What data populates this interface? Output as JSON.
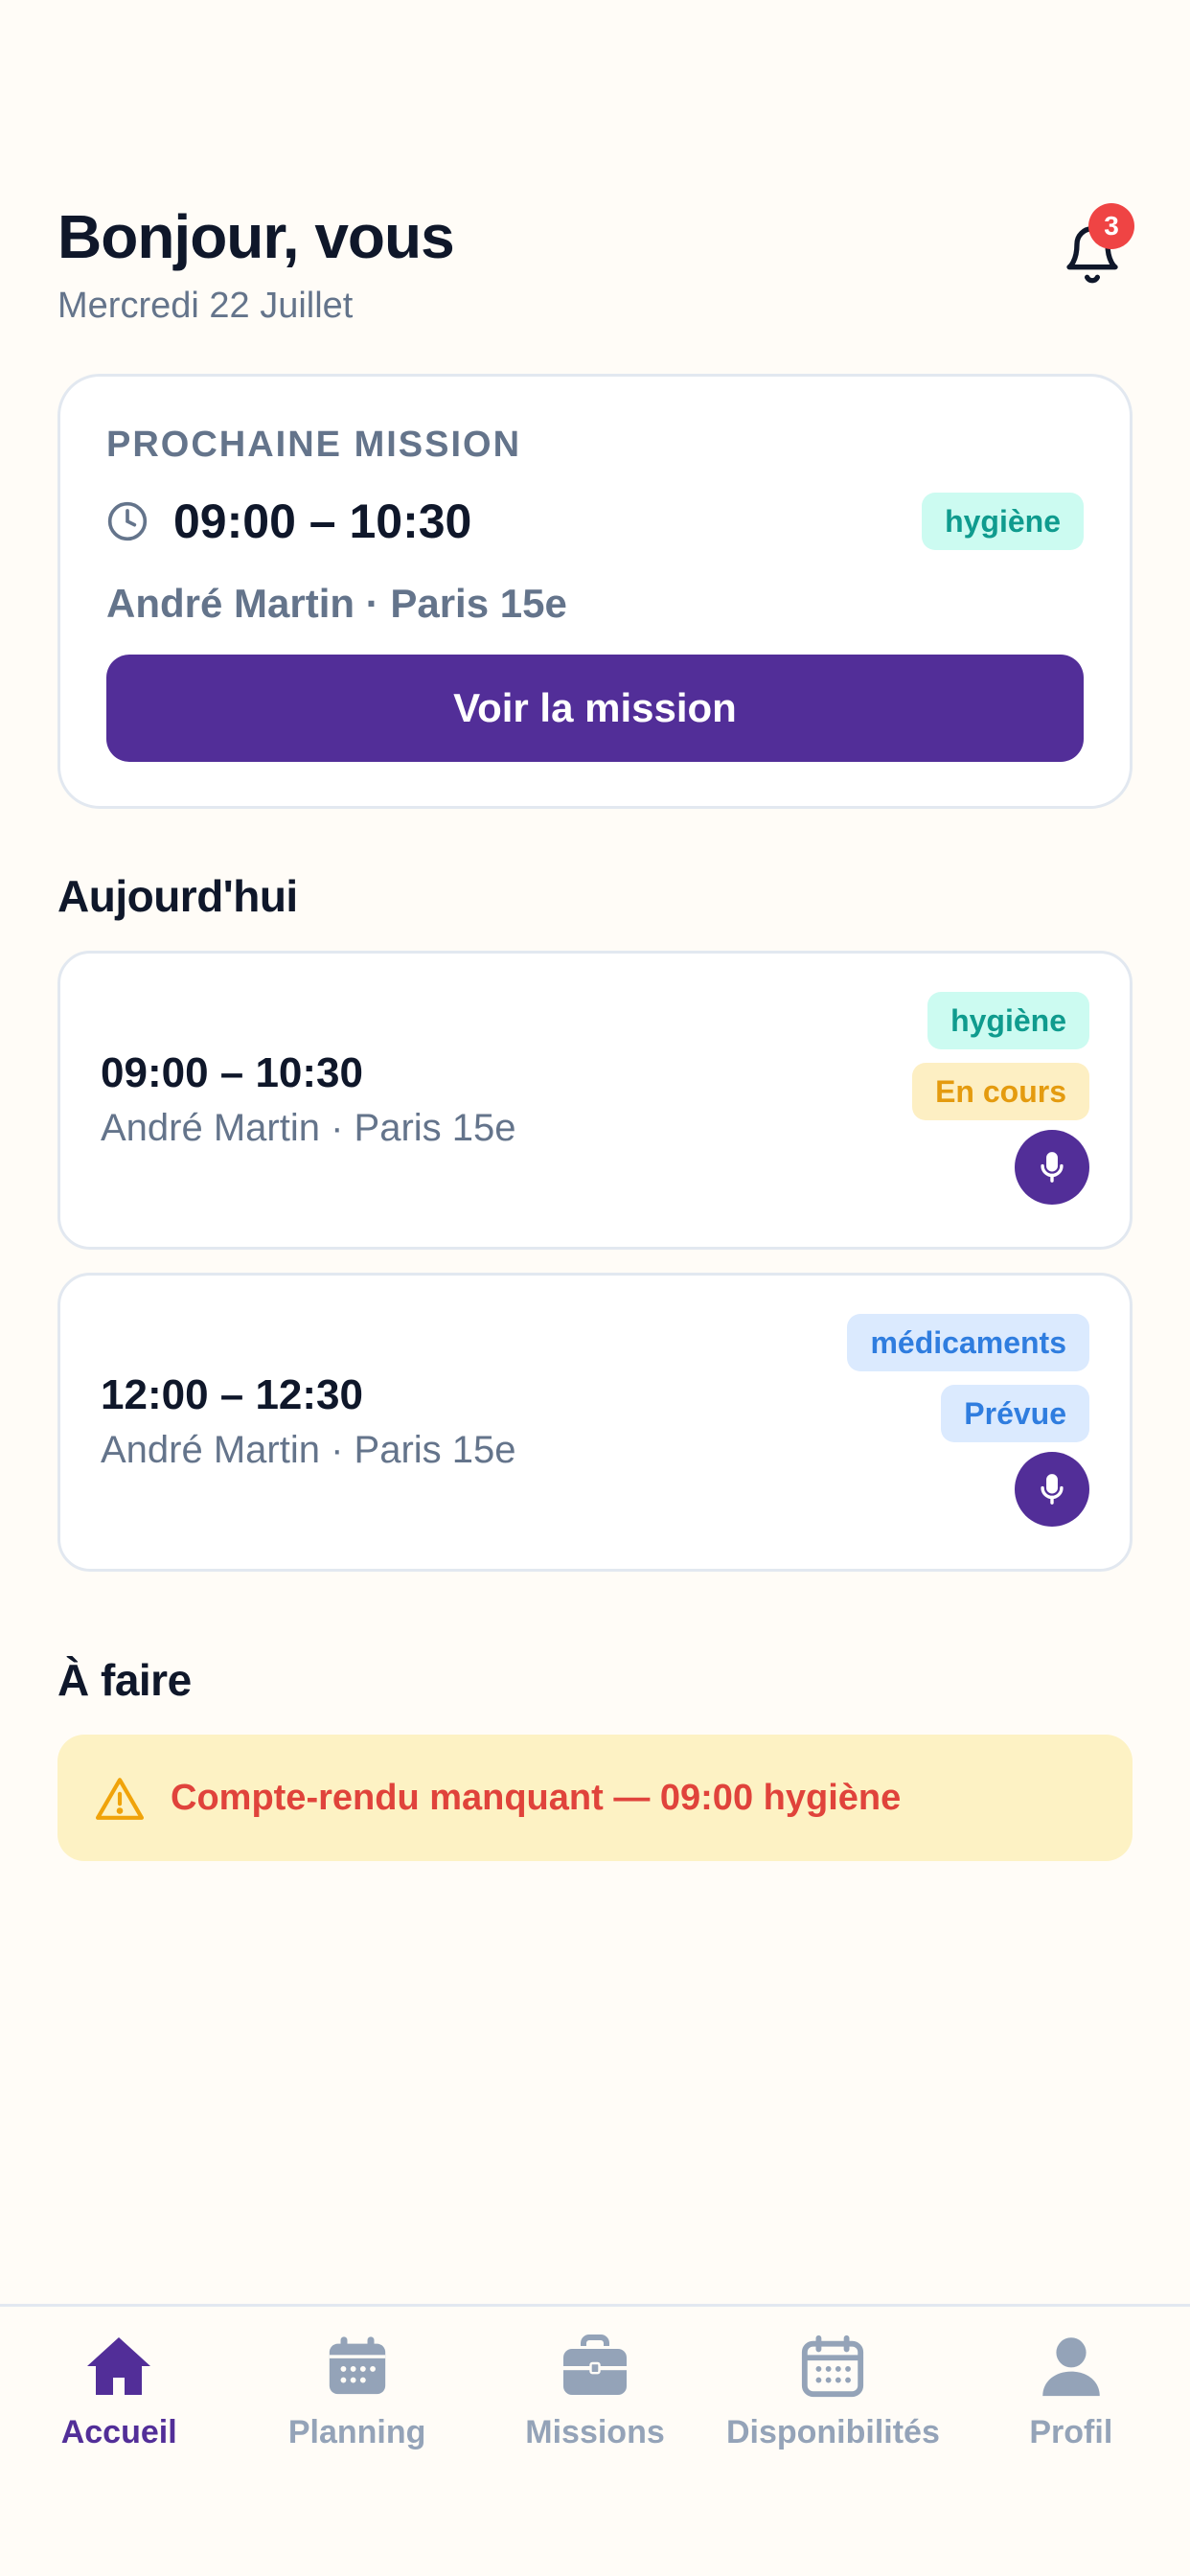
{
  "header": {
    "greeting": "Bonjour, vous",
    "date": "Mercredi 22 Juillet",
    "notification_count": "3"
  },
  "next_mission": {
    "label": "PROCHAINE MISSION",
    "time": "09:00 – 10:30",
    "tag": "hygiène",
    "person": "André Martin · Paris 15e",
    "button_label": "Voir la mission"
  },
  "today": {
    "title": "Aujourd'hui",
    "missions": [
      {
        "time": "09:00 – 10:30",
        "person": "André Martin · Paris 15e",
        "type_tag": "hygiène",
        "status_tag": "En cours"
      },
      {
        "time": "12:00 – 12:30",
        "person": "André Martin · Paris 15e",
        "type_tag": "médicaments",
        "status_tag": "Prévue"
      }
    ]
  },
  "todo": {
    "title": "À faire",
    "items": [
      {
        "text": "Compte-rendu manquant — 09:00 hygiène"
      }
    ]
  },
  "tabbar": {
    "tabs": [
      {
        "label": "Accueil",
        "icon": "home-icon",
        "active": true
      },
      {
        "label": "Planning",
        "icon": "calendar-icon",
        "active": false
      },
      {
        "label": "Missions",
        "icon": "briefcase-icon",
        "active": false
      },
      {
        "label": "Disponibilités",
        "icon": "calendar-grid-icon",
        "active": false
      },
      {
        "label": "Profil",
        "icon": "user-icon",
        "active": false
      }
    ]
  },
  "colors": {
    "primary": "#522e98",
    "background": "#fffcf7",
    "badge": "#ef4444",
    "warning_bg": "#fdf2c4",
    "warning_text": "#e0433b"
  }
}
